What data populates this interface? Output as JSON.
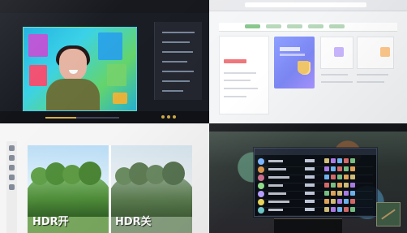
{
  "labels": {
    "hdr_on": "HDR开",
    "hdr_off": "HDR关"
  },
  "icons": [
    "play-icon",
    "close-icon",
    "tree-icon",
    "scoreboard-icon",
    "minimap-icon"
  ],
  "colors": {
    "video_blue": "#1cb0df",
    "promo_purple": "#8d9fff",
    "hdr_green": "#4f8d39",
    "game_dark": "#14161d",
    "accent_red": "#ef7478"
  },
  "video": {
    "progress": 0.42
  }
}
